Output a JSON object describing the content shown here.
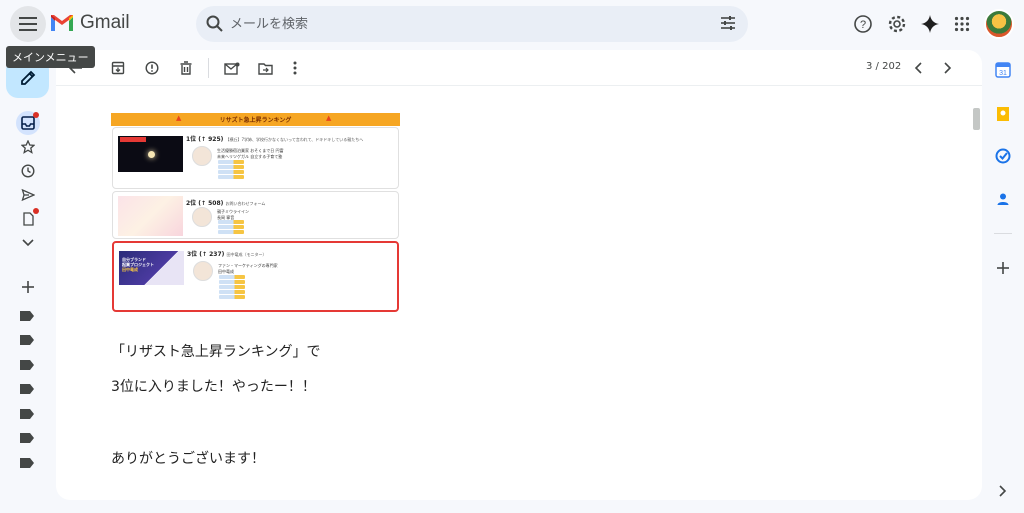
{
  "app": {
    "name": "Gmail",
    "tooltip": "メインメニュー"
  },
  "search": {
    "placeholder": "メールを検索"
  },
  "toolbar": {
    "pager": "3 / 202"
  },
  "ranking": {
    "title": "リサズト急上昇ランキング",
    "items": [
      {
        "rank": "1位 (↑ 925)",
        "subtitle": "【横丘】7学姉、学校行かなくないって言われて、ドキドキしている親たちへ",
        "author_line1": "生活優勝宿泊業家 おそくまで日 円富",
        "author_line2": "未来ヘリツゲガル 自立する子育て塾"
      },
      {
        "rank": "2位 (↑ 508)",
        "subtitle": "お問い合わせフォーム",
        "author_line1": "親子ミウライイン",
        "author_line2": "長岡 寧音"
      },
      {
        "rank": "3位 (↑ 237)",
        "subtitle": "田中竜成（モニター）",
        "author_line1": "ファン・マーケティングの専門家",
        "author_line2": "田中竜成",
        "thumb_line1": "自分ブランド",
        "thumb_line2": "起業プロジェクト",
        "thumb_line3": "田中竜成"
      }
    ]
  },
  "body": {
    "line1": "「リザスト急上昇ランキング」で",
    "line2": "3位に入りました！やったー！！",
    "line3": "ありがとうございます！"
  },
  "colors": {
    "accent": "#c2e7ff",
    "highlight_border": "#e53935",
    "ranking_header": "#f6a623"
  }
}
